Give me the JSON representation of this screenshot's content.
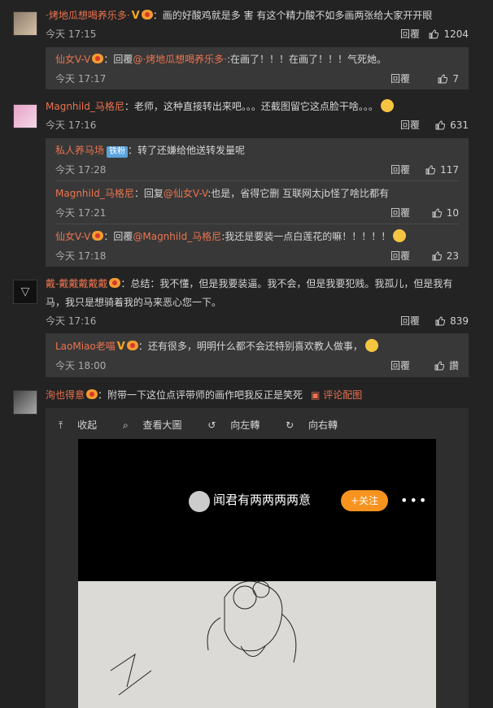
{
  "labels": {
    "reply": "回覆",
    "collapse": "收起",
    "view_large": "查看大圖",
    "rotate_left": "向左轉",
    "rotate_right": "向右轉"
  },
  "comments": [
    {
      "user": "·烤地瓜想喝养乐多·",
      "badge": "V",
      "text": "画的好酸鸡就是多 害 有这个精力酸不如多画两张给大家开开眼",
      "time": "今天 17:15",
      "likes": "1204",
      "replies": [
        {
          "user": "仙女V-V",
          "prefix": "：回覆",
          "mention": "@·烤地瓜想喝养乐多·",
          "text": ":在画了！！！在画了！！！气死她。",
          "time": "今天 17:17",
          "likes": "7"
        }
      ]
    },
    {
      "user": "Magnhild_马格尼",
      "text": "：老师，这种直接转出来吧。。。还截图留它这点脸干啥。。。",
      "time": "今天 17:16",
      "likes": "631",
      "replies": [
        {
          "user": "私人养马场",
          "badge": "铁粉",
          "text": "：转了还嫌给他送转发量呢",
          "time": "今天 17:28",
          "likes": "117"
        },
        {
          "user": "Magnhild_马格尼",
          "prefix": "：回复",
          "mention": "@仙女V-V",
          "text": ":也是，省得它删  互联网太jb怪了啥比都有",
          "time": "今天 17:21",
          "likes": "10"
        },
        {
          "user": "仙女V-V",
          "prefix": "：回覆",
          "mention": "@Magnhild_马格尼",
          "text": ":我还是要装一点白莲花的嘛！！！！！",
          "time": "今天 17:18",
          "likes": "23"
        }
      ]
    },
    {
      "user": "戴-戴戴戴戴戴",
      "text": "：总结：我不懂，但是我要装逼。我不会，但是我要犯贱。我孤儿，但是我有马，我只是想骑着我的马来恶心您一下。",
      "time": "今天 17:16",
      "likes": "839",
      "replies": [
        {
          "user": "LaoMiao老喵",
          "badge": "V",
          "text": "：还有很多，明明什么都不会还特别喜欢教人做事，",
          "time": "今天 18:00",
          "likes": "讚"
        }
      ]
    },
    {
      "user": "洵也得意",
      "text": "：附带一下这位点评带师的画作吧我反正是笑死",
      "pic_link": "评论配图"
    }
  ],
  "photo": {
    "name": "闻君有两两两两意",
    "follow": "+关注",
    "more": "•••"
  }
}
